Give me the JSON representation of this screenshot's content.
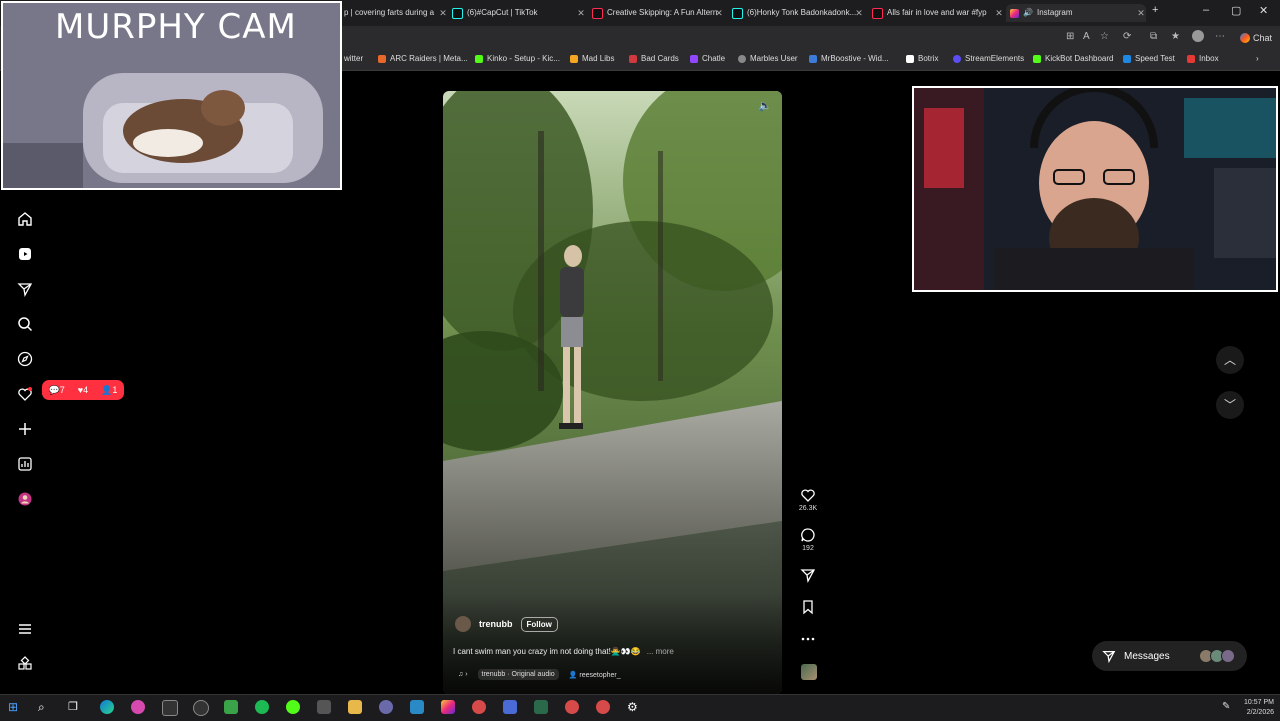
{
  "browser": {
    "tabs": [
      {
        "label": "p | covering farts during a"
      },
      {
        "label": "(6)#CapCut | TikTok"
      },
      {
        "label": "Creative Skipping: A Fun Altern"
      },
      {
        "label": "(6)Honky Tonk Badonkadonk..."
      },
      {
        "label": "Alls fair in love and war #fyp"
      },
      {
        "label": "Instagram"
      }
    ],
    "new_tab": "+",
    "chat_label": "Chat",
    "bookmarks": [
      {
        "label": "witter"
      },
      {
        "label": "ARC Raiders | Meta..."
      },
      {
        "label": "Kinko - Setup - Kic..."
      },
      {
        "label": "Mad Libs"
      },
      {
        "label": "Bad Cards"
      },
      {
        "label": "Chatle"
      },
      {
        "label": "Marbles User"
      },
      {
        "label": "MrBoostive - Wid..."
      },
      {
        "label": "Botrix"
      },
      {
        "label": "StreamElements"
      },
      {
        "label": "KickBot Dashboard"
      },
      {
        "label": "Speed Test"
      },
      {
        "label": "Inbox"
      }
    ]
  },
  "overlays": {
    "murphy_cam_title": "MURPHY CAM"
  },
  "notifications": {
    "comments": "7",
    "likes": "4",
    "follows": "1"
  },
  "reel": {
    "username": "trenubb",
    "follow_label": "Follow",
    "caption": "I cant swim man you crazy im not doing that!🙅‍♂️👀😂",
    "more_label": "... more",
    "audio": "trenubb · Original audio",
    "tagged_user": "reesetopher_",
    "likes": "26.3K",
    "comments": "192"
  },
  "messages": {
    "label": "Messages"
  },
  "taskbar": {
    "time": "10:57 PM",
    "date": "2/2/2026"
  },
  "colors": {
    "notification": "#ff3040",
    "background": "#000000"
  }
}
